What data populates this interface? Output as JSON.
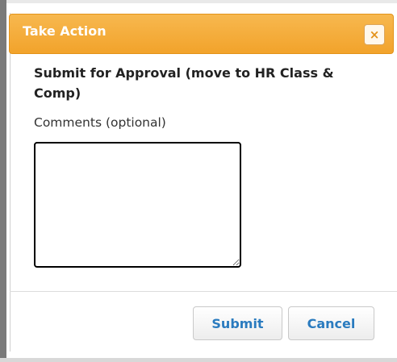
{
  "dialog": {
    "title": "Take Action",
    "close_icon": "close-icon",
    "close_glyph": "×",
    "action_label": "Submit for Approval (move to HR Class & Comp)",
    "comments_label": "Comments (optional)",
    "comments_value": "",
    "buttons": {
      "submit": "Submit",
      "cancel": "Cancel"
    }
  },
  "colors": {
    "titlebar": "#f2a32b",
    "button_text": "#2a7bbf",
    "close_icon": "#e3921a"
  }
}
